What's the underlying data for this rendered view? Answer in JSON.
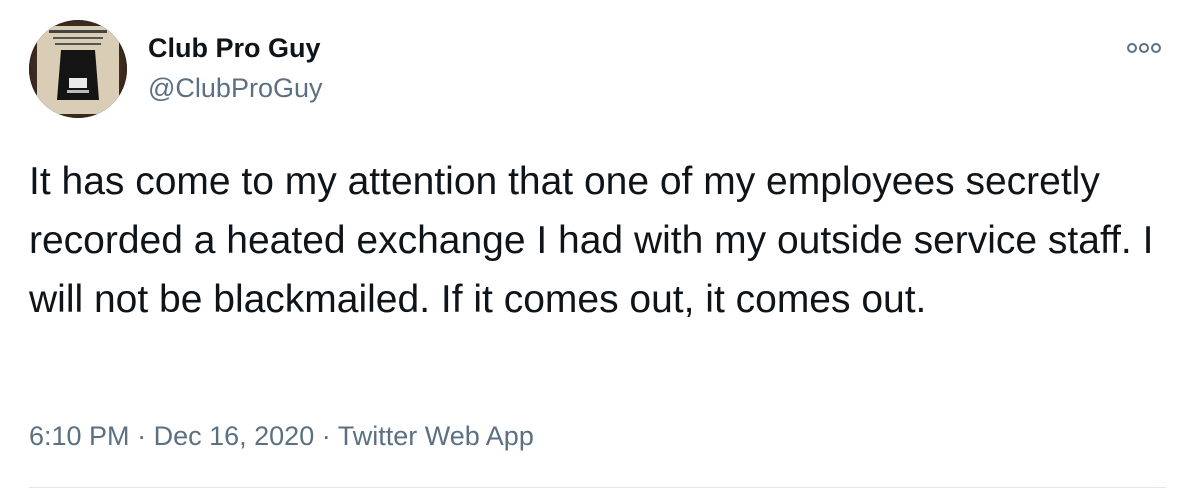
{
  "tweet": {
    "author": {
      "display_name": "Club Pro Guy",
      "handle": "@ClubProGuy",
      "avatar_icon": "profile-photo"
    },
    "more_icon": "more-options-icon",
    "text": "It has come to my attention that one of my employees secretly recorded a heated exchange I had with my outside service staff. I will not be blackmailed. If it comes out, it comes out.",
    "time": "6:10 PM",
    "separator": "·",
    "date": "Dec 16, 2020",
    "source": "Twitter Web App"
  },
  "colors": {
    "text": "#0f1419",
    "secondary": "#5b7083",
    "divider": "#e1e8ed"
  }
}
